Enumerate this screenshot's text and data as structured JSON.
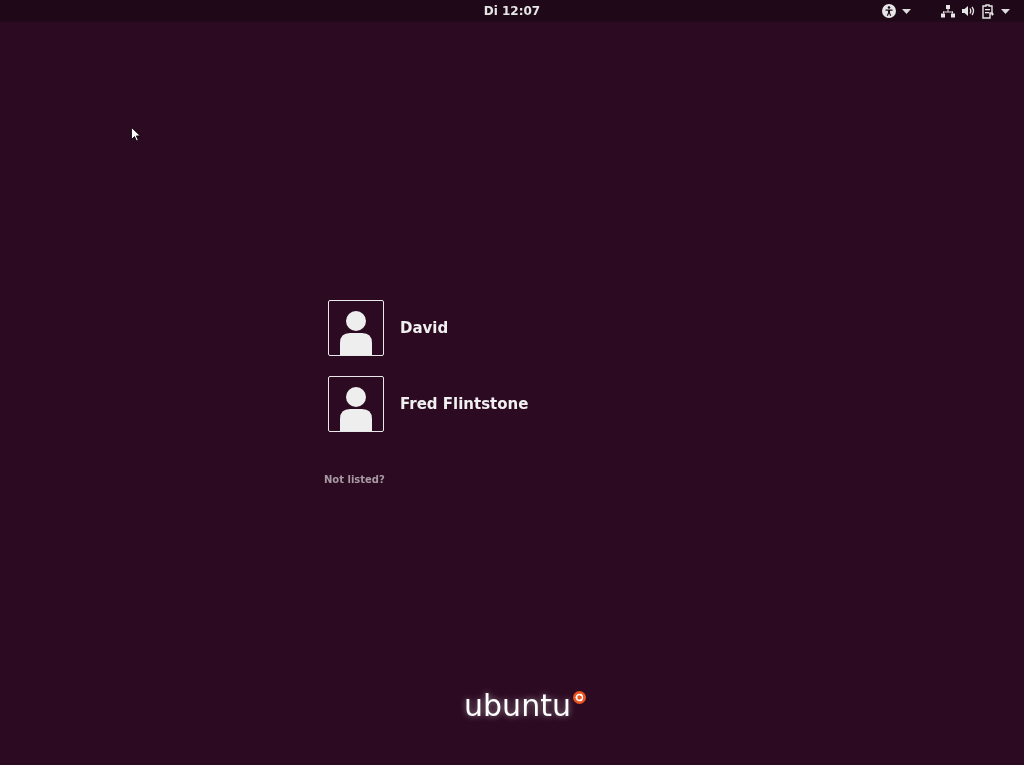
{
  "top_bar": {
    "clock": "Di 12:07"
  },
  "users": [
    {
      "name": "David"
    },
    {
      "name": "Fred Flintstone"
    }
  ],
  "not_listed": "Not listed?",
  "logo": "ubuntu"
}
